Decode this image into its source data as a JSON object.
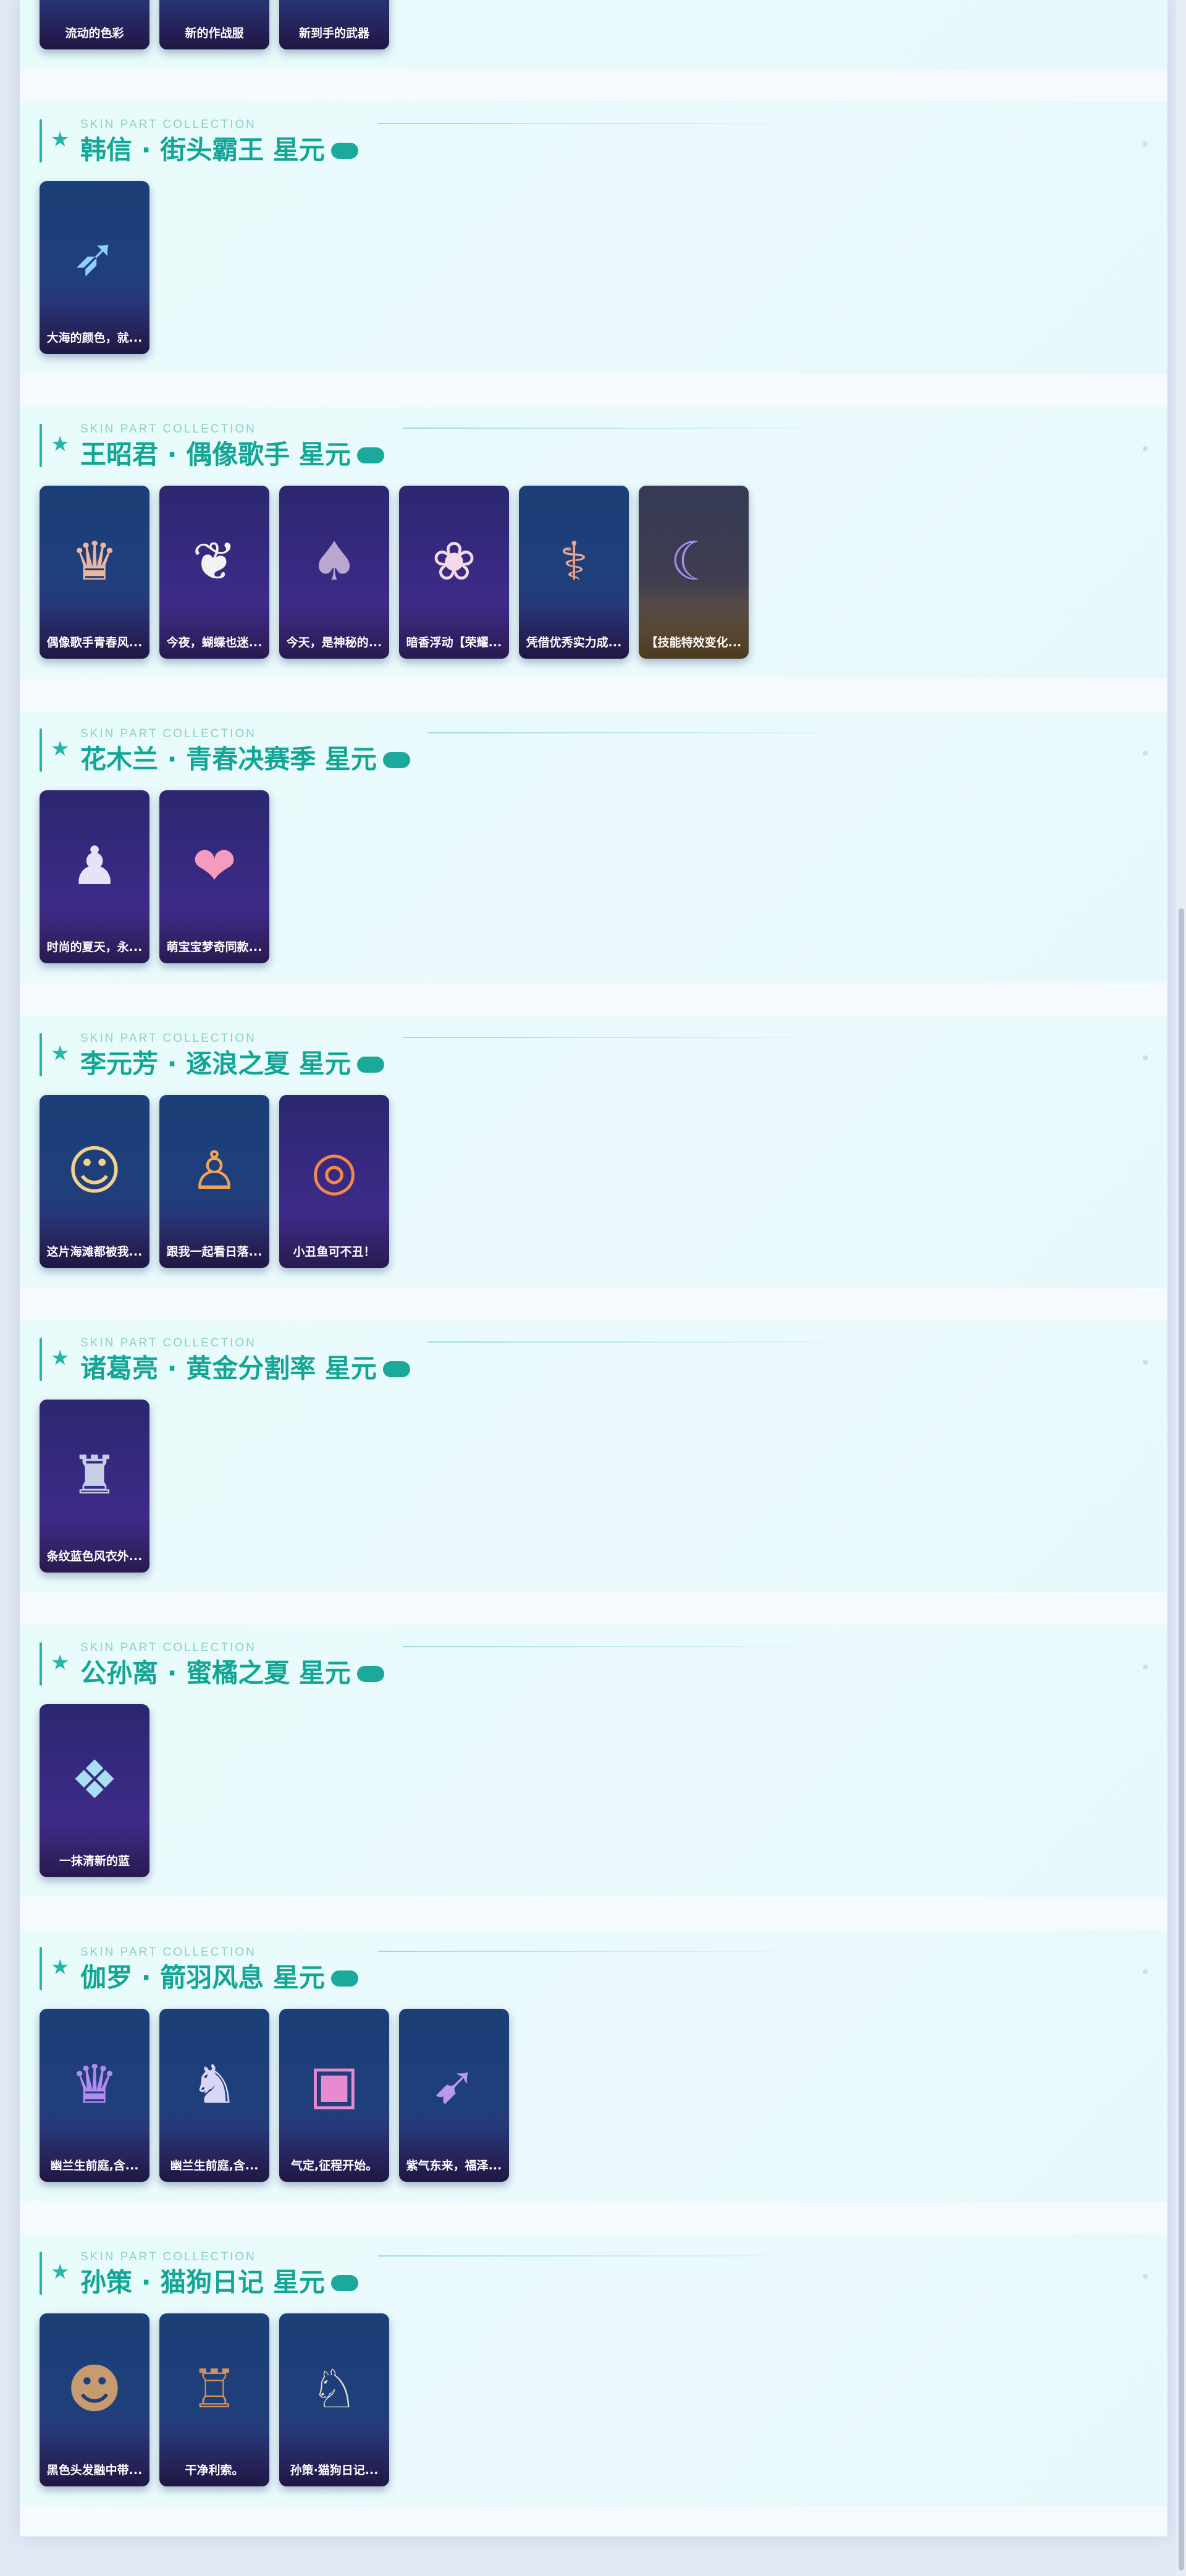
{
  "eyebrow": "SKIN PART COLLECTION",
  "top_cards": [
    "流动的色彩",
    "新的作战服",
    "新到手的武器"
  ],
  "sections": [
    {
      "title": "韩信 · 街头霸王 星元",
      "cards": [
        "大海的颜色，就..."
      ]
    },
    {
      "title": "王昭君 · 偶像歌手 星元",
      "cards": [
        "偶像歌手青春风...",
        "今夜，蝴蝶也迷...",
        "今天，是神秘的...",
        "暗香浮动【荣耀...",
        "凭借优秀实力成...",
        "【技能特效变化..."
      ]
    },
    {
      "title": "花木兰 · 青春决赛季 星元",
      "cards": [
        "时尚的夏天，永...",
        "萌宝宝梦奇同款..."
      ]
    },
    {
      "title": "李元芳 · 逐浪之夏 星元",
      "cards": [
        "这片海滩都被我...",
        "跟我一起看日落...",
        "小丑鱼可不丑！"
      ]
    },
    {
      "title": "诸葛亮 · 黄金分割率 星元",
      "cards": [
        "条纹蓝色风衣外..."
      ]
    },
    {
      "title": "公孙离 · 蜜橘之夏 星元",
      "cards": [
        "一抹清新的蓝"
      ]
    },
    {
      "title": "伽罗 · 箭羽风息 星元",
      "cards": [
        "幽兰生前庭,含...",
        "幽兰生前庭,含...",
        "气定,征程开始。",
        "紫气东来，福泽..."
      ]
    },
    {
      "title": "孙策 · 猫狗日记 星元",
      "cards": [
        "黑色头发融中带...",
        "干净利索。",
        "孙策·猫狗日记..."
      ]
    }
  ],
  "icons": {
    "section_star": "star-icon"
  },
  "colors": {
    "accent": "#13a596",
    "eyebrow": "#8fcfc6",
    "page_bg": "#f4fafe"
  }
}
